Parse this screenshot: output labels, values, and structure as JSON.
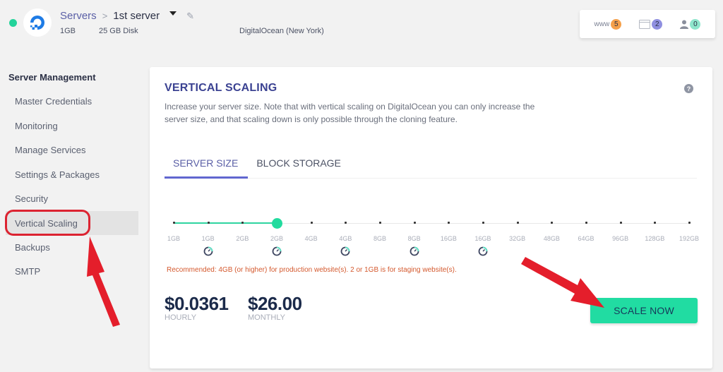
{
  "header": {
    "status": "online",
    "breadcrumb_parent": "Servers",
    "breadcrumb_separator": ">",
    "server_name": "1st server",
    "ram": "1GB",
    "disk": "25 GB Disk",
    "provider": "DigitalOcean (New York)"
  },
  "counters": [
    {
      "icon": "www-icon",
      "label": "www",
      "count": "5",
      "color": "#f5a04a"
    },
    {
      "icon": "folder-icon",
      "label": "",
      "count": "2",
      "color": "#8f8fe0"
    },
    {
      "icon": "user-icon",
      "label": "",
      "count": "0",
      "color": "#8ee6cc"
    }
  ],
  "sidebar": {
    "title": "Server Management",
    "items": [
      {
        "label": "Master Credentials"
      },
      {
        "label": "Monitoring"
      },
      {
        "label": "Manage Services"
      },
      {
        "label": "Settings & Packages"
      },
      {
        "label": "Security"
      },
      {
        "label": "Vertical Scaling",
        "active": true
      },
      {
        "label": "Backups"
      },
      {
        "label": "SMTP"
      }
    ]
  },
  "card": {
    "title": "VERTICAL SCALING",
    "help_icon": "?",
    "description": "Increase your server size. Note that with vertical scaling on DigitalOcean you can only increase the server size, and that scaling down is only possible through the cloning feature.",
    "tabs": [
      {
        "label": "SERVER SIZE",
        "active": true
      },
      {
        "label": "BLOCK STORAGE",
        "active": false
      }
    ],
    "slider": {
      "options": [
        "1GB",
        "1GB",
        "2GB",
        "2GB",
        "4GB",
        "4GB",
        "8GB",
        "8GB",
        "16GB",
        "16GB",
        "32GB",
        "48GB",
        "64GB",
        "96GB",
        "128GB",
        "192GB"
      ],
      "speed_icon_indices": [
        1,
        3,
        5,
        7,
        9
      ],
      "selected_index": 3
    },
    "recommendation": "Recommended: 4GB (or higher) for production website(s). 2 or 1GB is for staging website(s).",
    "hourly_price": "$0.0361",
    "hourly_label": "HOURLY",
    "monthly_price": "$26.00",
    "monthly_label": "MONTHLY",
    "scale_button": "SCALE NOW"
  },
  "colors": {
    "accent": "#22db9e",
    "title": "#3b4292",
    "annotation": "#dc2331"
  }
}
